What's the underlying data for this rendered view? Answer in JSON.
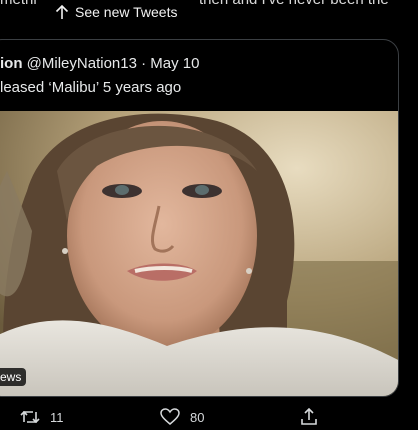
{
  "background_tweet": {
    "left_fragment": "methi",
    "right_fragment": "then and I've never been the"
  },
  "new_tweets_pill": {
    "label": "See new Tweets"
  },
  "quoted_tweet": {
    "author_name": "ion",
    "handle": "@MileyNation13",
    "separator": "·",
    "date": "May 10",
    "text": "leased ‘Malibu’ 5 years ago",
    "media_label": "ews"
  },
  "actions": {
    "retweet_count": "11",
    "like_count": "80"
  },
  "colors": {
    "background": "#000000",
    "text": "#e7e9ea",
    "card_border": "#3b3f43"
  }
}
